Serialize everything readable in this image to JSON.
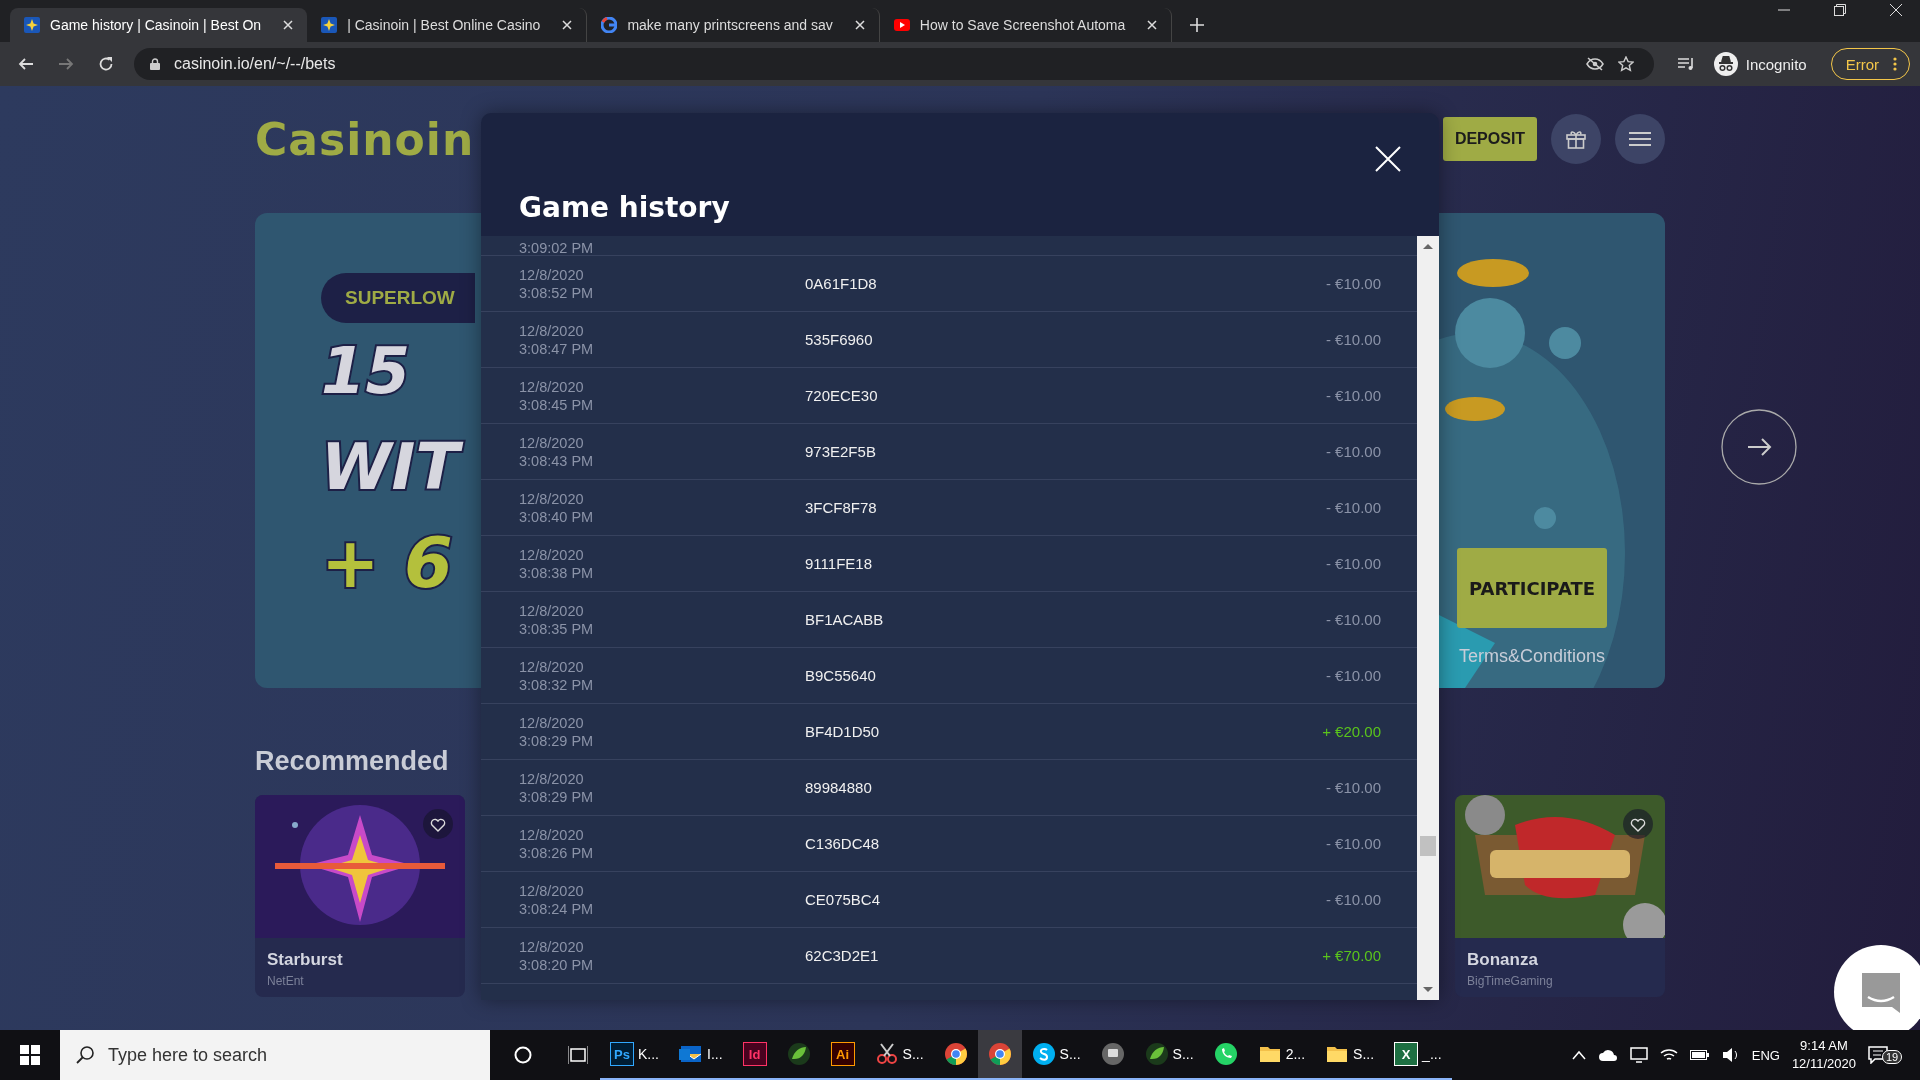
{
  "browser": {
    "tabs": [
      {
        "title": "Game history | Casinoin | Best On",
        "kind": "casino",
        "selected": true
      },
      {
        "title": "| Casinoin | Best Online Casino",
        "kind": "casino",
        "selected": false
      },
      {
        "title": "make many printscreens and sav",
        "kind": "google",
        "selected": false
      },
      {
        "title": "How to Save Screenshot Automa",
        "kind": "youtube",
        "selected": false
      }
    ],
    "address": "casinoin.io/en/~/--/bets",
    "profile": "Incognito",
    "error_button": "Error"
  },
  "site": {
    "logo": "Casinoin",
    "deposit_button": "DEPOSIT",
    "banner": {
      "pill": "SUPERLOW",
      "line_1": "15",
      "line_2": "WIT",
      "line_3": "+ 6",
      "participate_button": "PARTICIPATE",
      "terms_link": "Terms&Conditions"
    },
    "section_title": "Recommended",
    "games": [
      {
        "name": "Starburst",
        "provider": "NetEnt"
      },
      {
        "name": "Bonanza",
        "provider": "BigTimeGaming"
      }
    ]
  },
  "modal": {
    "title": "Game history",
    "rows": [
      {
        "time": "3:09:02 PM"
      },
      {
        "date": "12/8/2020",
        "time": "3:08:52 PM",
        "id": "0A61F1D8",
        "amount": "- €10.00",
        "kind": "loss"
      },
      {
        "date": "12/8/2020",
        "time": "3:08:47 PM",
        "id": "535F6960",
        "amount": "- €10.00",
        "kind": "loss"
      },
      {
        "date": "12/8/2020",
        "time": "3:08:45 PM",
        "id": "720ECE30",
        "amount": "- €10.00",
        "kind": "loss"
      },
      {
        "date": "12/8/2020",
        "time": "3:08:43 PM",
        "id": "973E2F5B",
        "amount": "- €10.00",
        "kind": "loss"
      },
      {
        "date": "12/8/2020",
        "time": "3:08:40 PM",
        "id": "3FCF8F78",
        "amount": "- €10.00",
        "kind": "loss"
      },
      {
        "date": "12/8/2020",
        "time": "3:08:38 PM",
        "id": "9111FE18",
        "amount": "- €10.00",
        "kind": "loss"
      },
      {
        "date": "12/8/2020",
        "time": "3:08:35 PM",
        "id": "BF1ACABB",
        "amount": "- €10.00",
        "kind": "loss"
      },
      {
        "date": "12/8/2020",
        "time": "3:08:32 PM",
        "id": "B9C55640",
        "amount": "- €10.00",
        "kind": "loss"
      },
      {
        "date": "12/8/2020",
        "time": "3:08:29 PM",
        "id": "BF4D1D50",
        "amount": "+ €20.00",
        "kind": "win"
      },
      {
        "date": "12/8/2020",
        "time": "3:08:29 PM",
        "id": "89984880",
        "amount": "- €10.00",
        "kind": "loss"
      },
      {
        "date": "12/8/2020",
        "time": "3:08:26 PM",
        "id": "C136DC48",
        "amount": "- €10.00",
        "kind": "loss"
      },
      {
        "date": "12/8/2020",
        "time": "3:08:24 PM",
        "id": "CE075BC4",
        "amount": "- €10.00",
        "kind": "loss"
      },
      {
        "date": "12/8/2020",
        "time": "3:08:20 PM",
        "id": "62C3D2E1",
        "amount": "+ €70.00",
        "kind": "win"
      }
    ]
  },
  "taskbar": {
    "search": {
      "placeholder": "Type here to search"
    },
    "apps": [
      {
        "kind": "ps",
        "glyph": "Ps",
        "label": "K...",
        "selected": false
      },
      {
        "kind": "outlook",
        "label": "I...",
        "selected": false
      },
      {
        "kind": "id",
        "glyph": "Id",
        "selected": false
      },
      {
        "kind": "leaf",
        "selected": false
      },
      {
        "kind": "ai",
        "glyph": "Ai",
        "selected": false
      },
      {
        "kind": "snip",
        "label": "S...",
        "selected": false
      },
      {
        "kind": "chrome",
        "selected": false
      },
      {
        "kind": "chrome",
        "selected": true
      },
      {
        "kind": "skype",
        "label": "S...",
        "selected": false
      },
      {
        "kind": "chat",
        "selected": false
      },
      {
        "kind": "leaf",
        "label": "S...",
        "selected": false
      },
      {
        "kind": "whatsapp",
        "selected": false
      },
      {
        "kind": "folder",
        "label": "2...",
        "selected": false
      },
      {
        "kind": "folder",
        "label": "S...",
        "selected": false
      },
      {
        "kind": "excel",
        "glyph": "X",
        "label": "_...",
        "selected": false
      }
    ],
    "language": "ENG",
    "time": "9:14 AM",
    "date": "12/11/2020",
    "notifications": "19"
  }
}
